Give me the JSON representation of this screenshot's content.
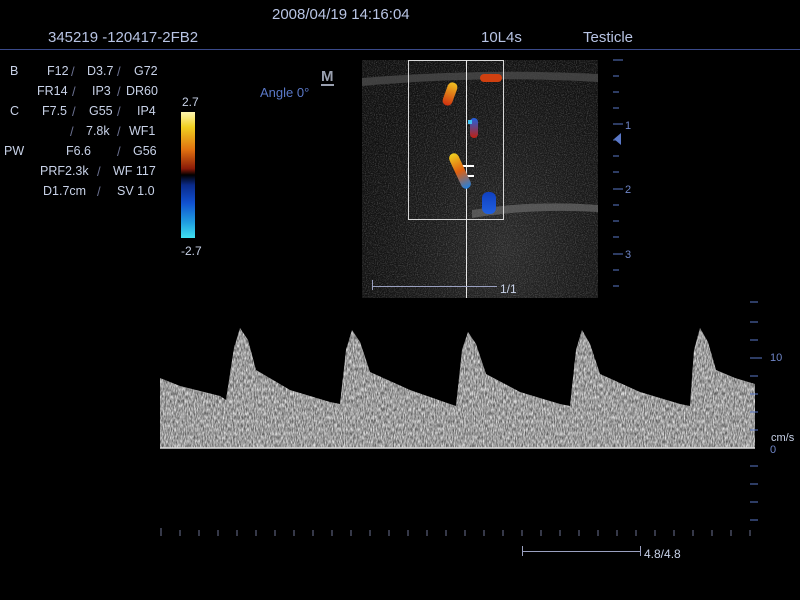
{
  "header": {
    "datetime": "2008/04/19   14:16:04",
    "patient_id": "345219 -120417-2FB2",
    "probe": "10L4s",
    "preset": "Testicle"
  },
  "params": {
    "b_label": "B",
    "b_row1": [
      "F12",
      "D3.7",
      "G72"
    ],
    "b_row2": [
      "FR14",
      "IP3",
      "DR60"
    ],
    "c_label": "C",
    "c_row1": [
      "F7.5",
      "G55",
      "IP4"
    ],
    "c_row2": [
      "7.8k",
      "WF1"
    ],
    "pw_label": "PW",
    "pw_row1": [
      "F6.6",
      "G56"
    ],
    "pw_row2": [
      "PRF2.3k",
      "WF 117"
    ],
    "pw_row3": [
      "D1.7cm",
      "SV 1.0"
    ]
  },
  "angle": "Angle 0°",
  "marker": "M",
  "colorbar": {
    "max": "2.7",
    "min": "-2.7"
  },
  "depth_scale": [
    "1",
    "2",
    "3"
  ],
  "bmode_counter": "1/1",
  "velocity_scale": {
    "tick": "10",
    "unit": "cm/s",
    "zero": "0"
  },
  "sweep": "4.8/4.8",
  "colors": {
    "bg": "#000000",
    "text": "#c8d2e8",
    "accent": "#5a78c8"
  }
}
